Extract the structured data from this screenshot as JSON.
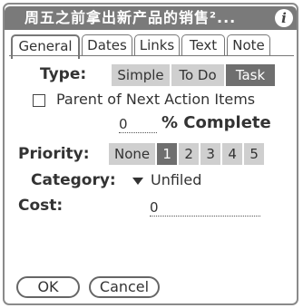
{
  "title": "周五之前拿出新产品的销售²...",
  "tabs": [
    {
      "label": "General",
      "active": true
    },
    {
      "label": "Dates",
      "active": false
    },
    {
      "label": "Links",
      "active": false
    },
    {
      "label": "Text",
      "active": false
    },
    {
      "label": "Note",
      "active": false
    }
  ],
  "type": {
    "label": "Type:",
    "options": [
      "Simple",
      "To Do",
      "Task"
    ],
    "selected": "Task"
  },
  "parent_checkbox": {
    "label": "Parent of Next Action Items",
    "checked": false
  },
  "percent": {
    "value": "0",
    "label": "% Complete"
  },
  "priority": {
    "label": "Priority:",
    "options": [
      "None",
      "1",
      "2",
      "3",
      "4",
      "5"
    ],
    "selected": "1"
  },
  "category": {
    "label": "Category:",
    "value": "Unfiled"
  },
  "cost": {
    "label": "Cost:",
    "value": "0"
  },
  "buttons": {
    "ok": "OK",
    "cancel": "Cancel"
  },
  "colors": {
    "title_bar": "#7a7a7a",
    "selected": "#6f6f6f",
    "unselected": "#cfcfcf"
  }
}
